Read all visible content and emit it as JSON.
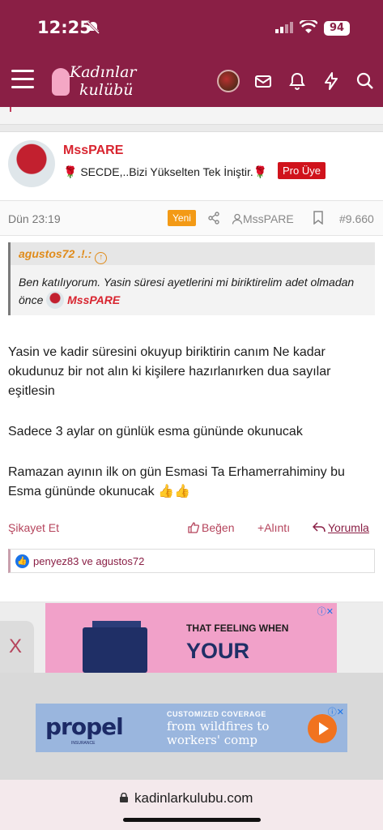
{
  "status_bar": {
    "time": "12:25",
    "battery": "94"
  },
  "nav": {
    "logo_line1": "Kadınlar",
    "logo_line2": "kulübü"
  },
  "post": {
    "username": "MssPARE",
    "user_title": "SECDE,..Bizi Yükselten Tek İniştir.",
    "badge": "Pro Üye",
    "date": "Dün 23:19",
    "new_label": "Yeni",
    "author": "MssPARE",
    "post_number": "#9.660",
    "quote": {
      "author": "agustos72 .!.:",
      "text": "Ben katılıyorum. Yasin süresi ayetlerini mi biriktirelim adet olmadan önce",
      "mention": "MssPARE"
    },
    "paragraphs": [
      "Yasin ve kadir süresini okuyup biriktirin canım Ne kadar okudunuz bir not alın ki kişilere hazırlanırken dua sayılar eşitlesin",
      "Sadece 3 aylar on günlük esma gününde okunucak",
      "Ramazan ayının ilk on gün Esmasi Ta Erhamerrahiminy bu Esma gününde okunucak 👍👍"
    ],
    "actions": {
      "report": "Şikayet Et",
      "like": "Beğen",
      "quote": "Alıntı",
      "reply": "Yorumla"
    },
    "likes_text": "penyez83 ve agustos72"
  },
  "ad1": {
    "line1": "THAT FEELING WHEN",
    "line2": "YOUR"
  },
  "close_tab": "X",
  "ad2": {
    "brand": "propel",
    "brand_sub": "INSURANCE",
    "tag": "CUSTOMIZED COVERAGE",
    "headline": "from wildfires to workers' comp"
  },
  "browser": {
    "url": "kadinlarkulubu.com"
  },
  "colors": {
    "brand": "#8a1f45",
    "username": "#d8242f",
    "badge": "#d0131c",
    "new": "#f39a16"
  }
}
